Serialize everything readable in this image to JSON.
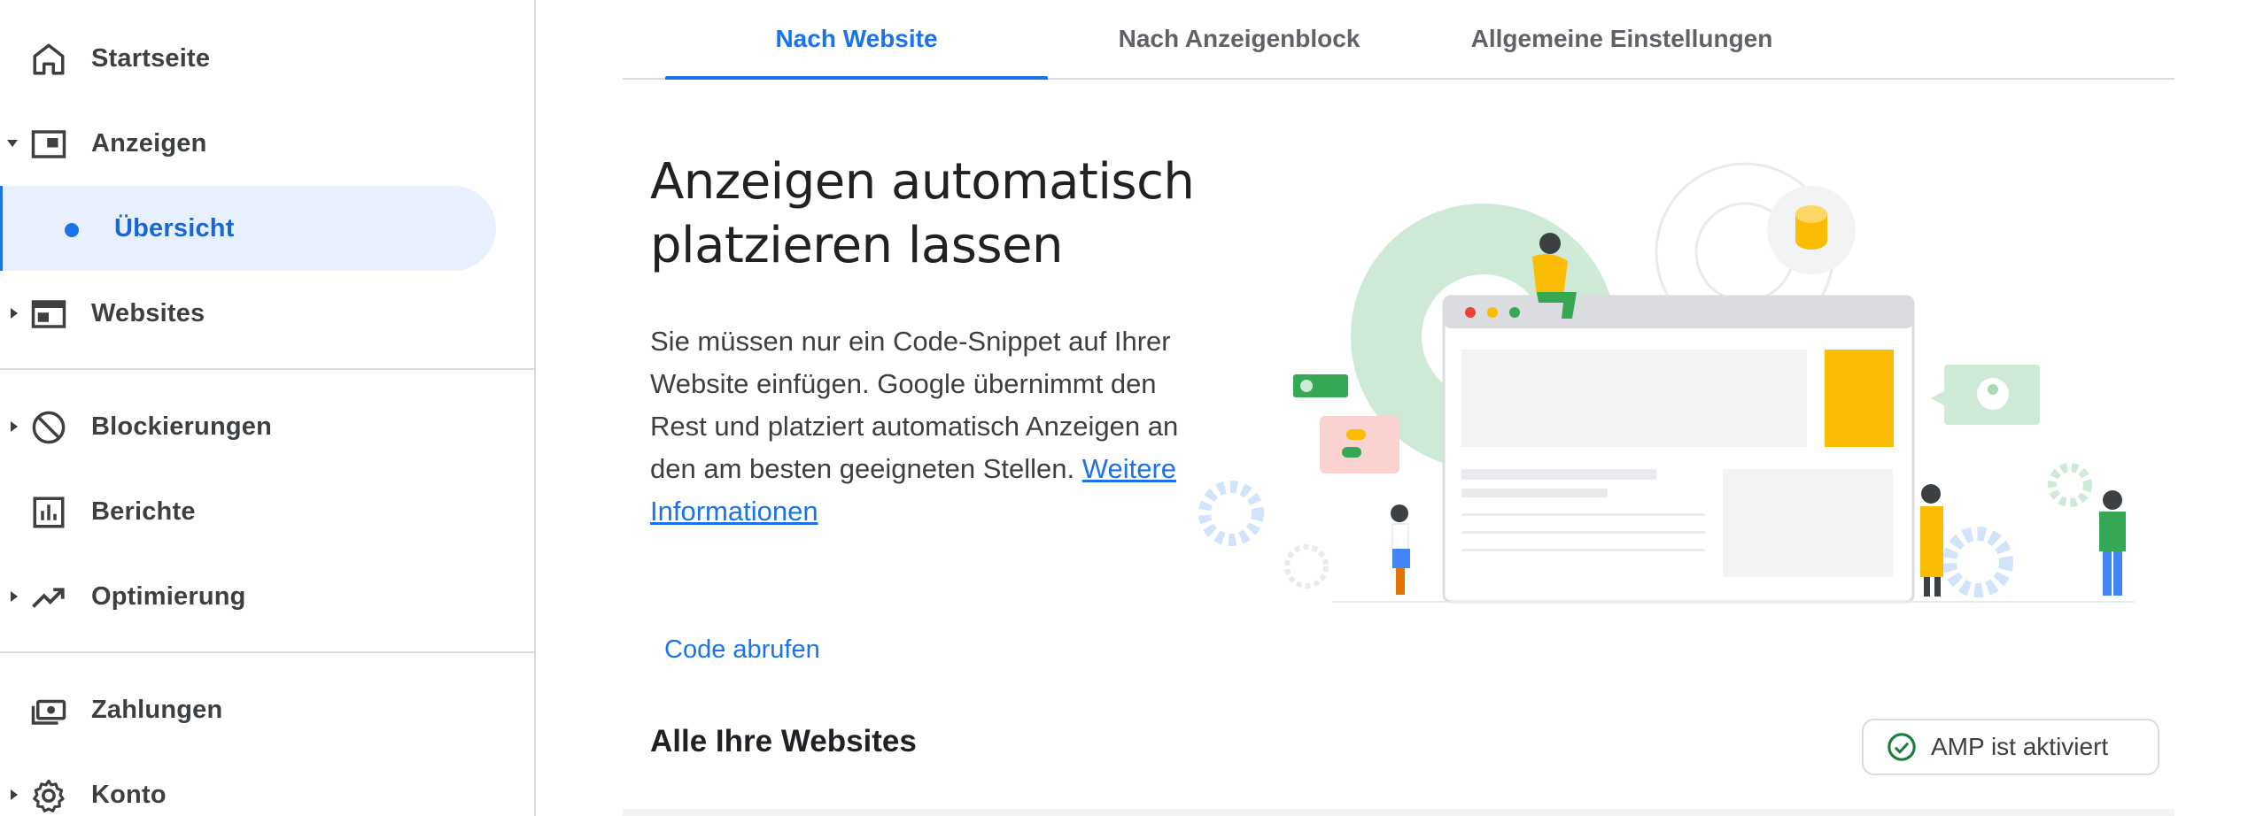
{
  "sidebar": {
    "items": [
      {
        "label": "Startseite",
        "icon": "home-icon"
      },
      {
        "label": "Anzeigen",
        "icon": "ads-icon"
      },
      {
        "label": "Übersicht",
        "icon": "dot-icon"
      },
      {
        "label": "Websites",
        "icon": "websites-icon"
      },
      {
        "label": "Blockierungen",
        "icon": "block-icon"
      },
      {
        "label": "Berichte",
        "icon": "reports-icon"
      },
      {
        "label": "Optimierung",
        "icon": "trending-up-icon"
      },
      {
        "label": "Zahlungen",
        "icon": "payments-icon"
      },
      {
        "label": "Konto",
        "icon": "gear-icon"
      }
    ]
  },
  "tabs": [
    {
      "label": "Nach Website",
      "active": true
    },
    {
      "label": "Nach Anzeigenblock",
      "active": false
    },
    {
      "label": "Allgemeine Einstellungen",
      "active": false
    }
  ],
  "main": {
    "headline_line1": "Anzeigen automatisch",
    "headline_line2": "platzieren lassen",
    "description": "Sie müssen nur ein Code-Snippet auf Ihrer Website einfügen. Google übernimmt den Rest und platziert automatisch Anzeigen an den am besten geeigneten Stellen.",
    "link_label": "Weitere Informationen",
    "code_button": "Code abrufen",
    "section_title": "Alle Ihre Websites",
    "amp_chip": "AMP ist aktiviert"
  },
  "colors": {
    "accent": "#1a73e8",
    "active_bg": "#e8f0fe",
    "success": "#188038",
    "ad_yellow": "#fbbc04"
  }
}
